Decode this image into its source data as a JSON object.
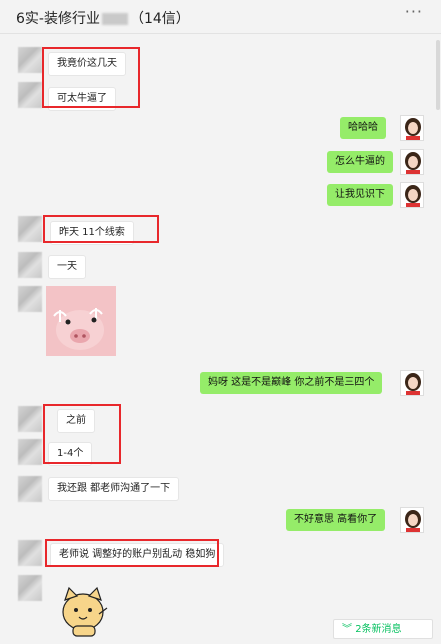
{
  "header": {
    "title_prefix": "6实-装修行业",
    "title_suffix": "（14信）",
    "more_icon": "···"
  },
  "messages": {
    "m1": "我竟价这几天",
    "m2": "可太牛逼了",
    "m3": "哈哈哈",
    "m4": "怎么牛逼的",
    "m5": "让我见识下",
    "m6": "昨天 11个线索",
    "m7": "一天",
    "m8": "妈呀   这是不是巅峰   你之前不是三四个",
    "m9": "之前",
    "m10": "1-4个",
    "m11": "我还跟 都老师沟通了一下",
    "m12": "不好意思     高看你了",
    "m13": "老师说 调整好的账户别乱动  稳如狗"
  },
  "new_messages": {
    "icon": "double-chevron-down",
    "label": "2条新消息"
  },
  "colors": {
    "outgoing": "#95ec69",
    "incoming": "#ffffff",
    "highlight": "#e8272b",
    "accent": "#07c160"
  }
}
